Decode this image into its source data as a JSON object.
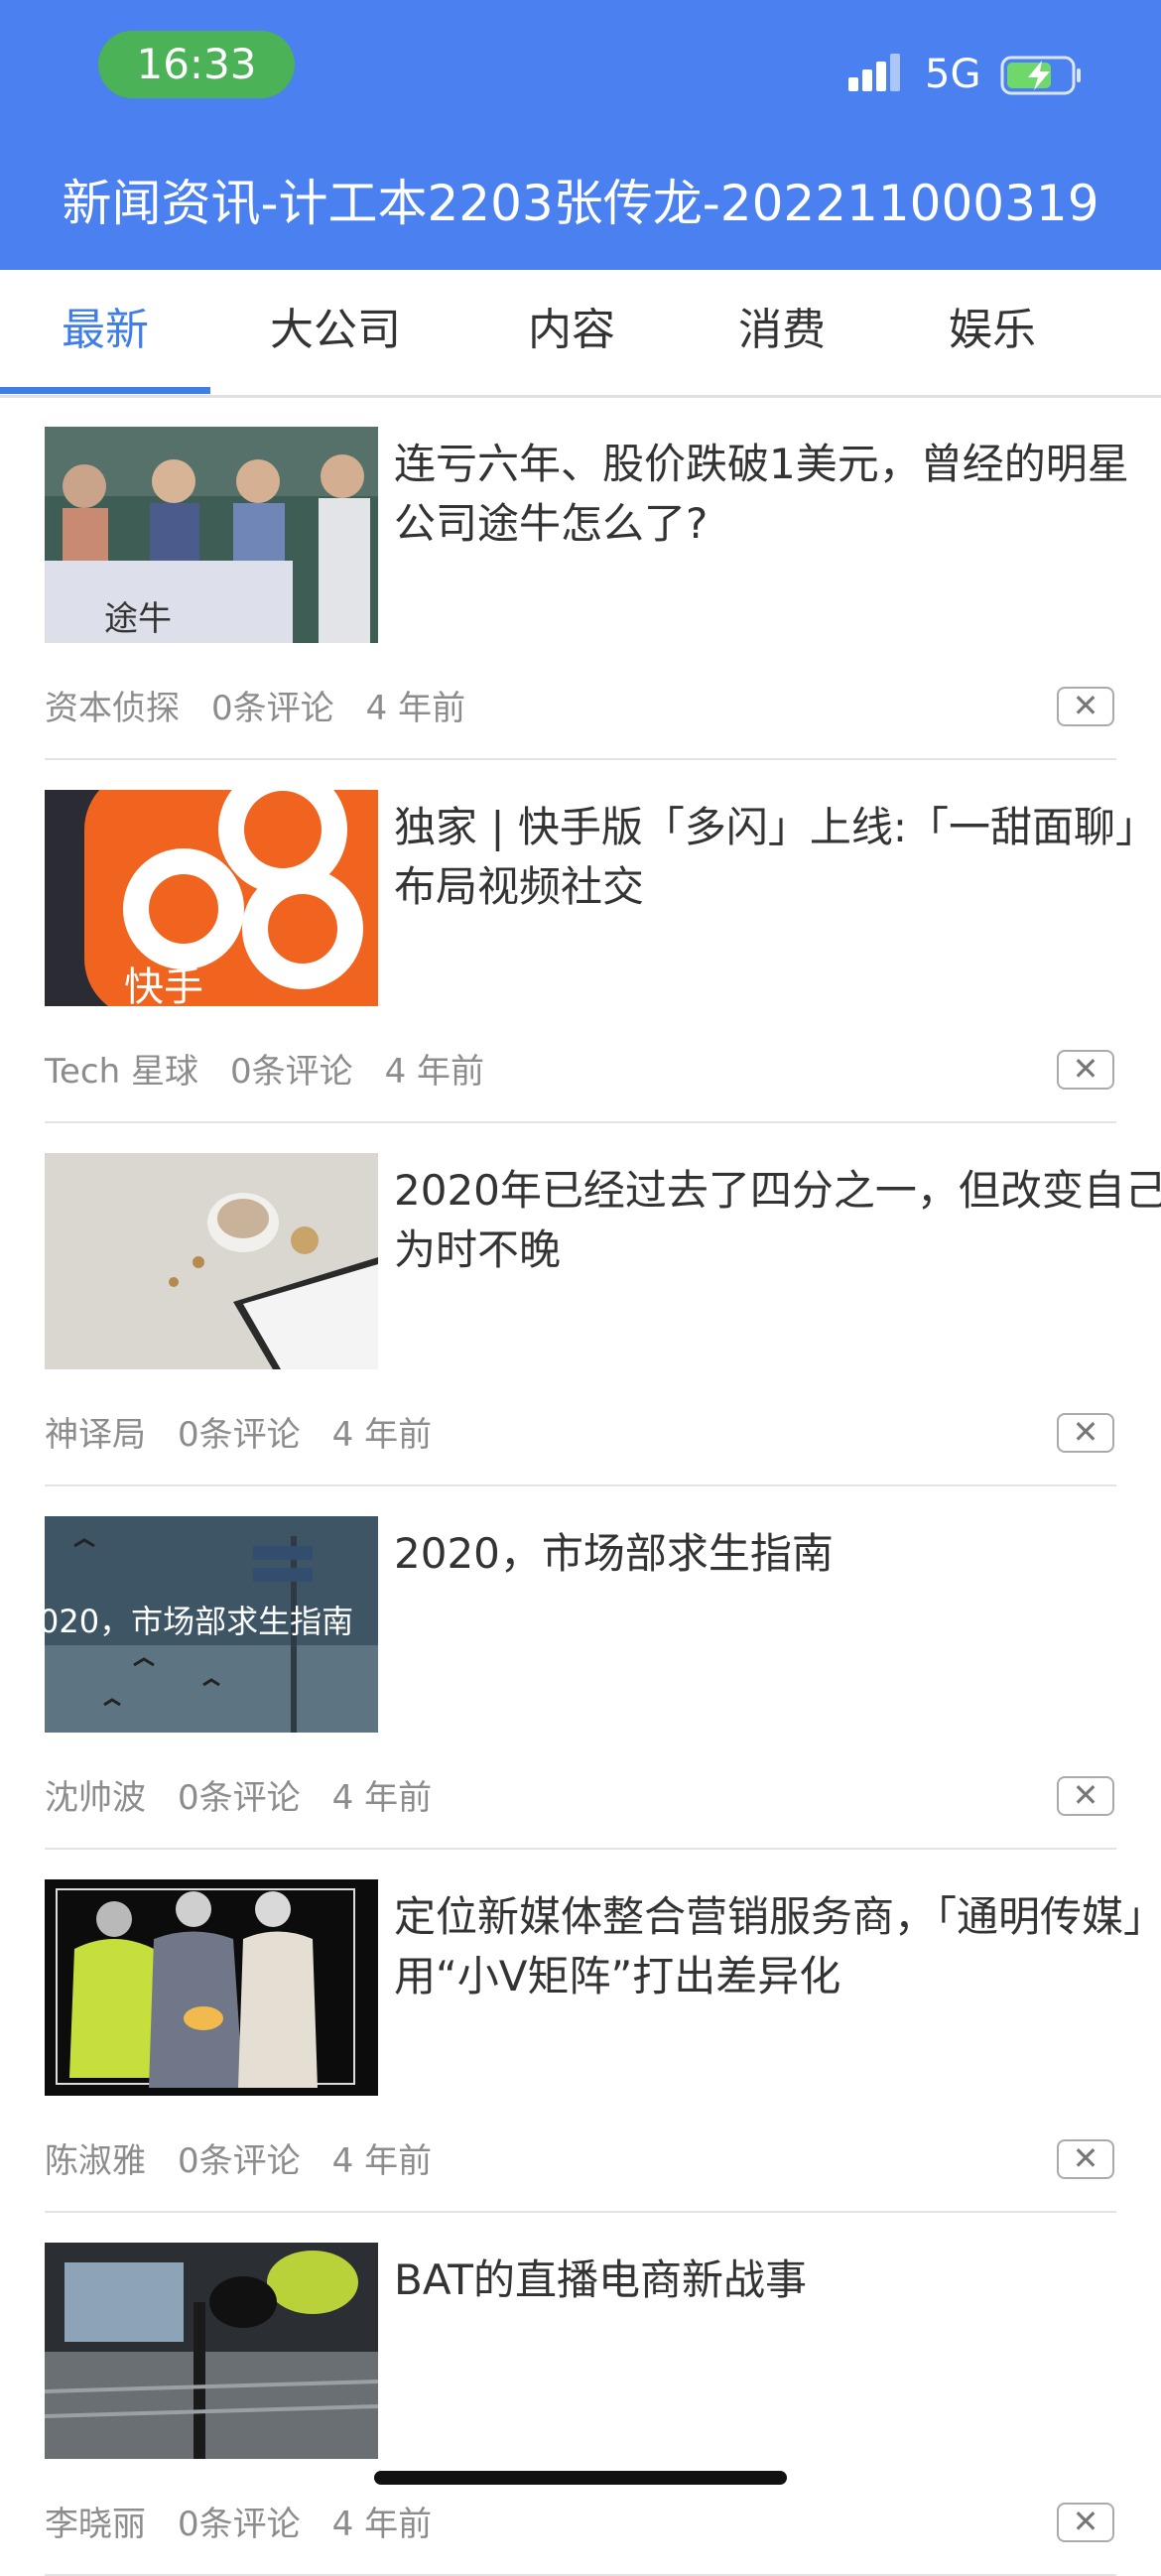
{
  "status_bar": {
    "time": "16:33",
    "network": "5G",
    "signal_icon": "signal-bars-icon",
    "battery_icon": "battery-charging-icon"
  },
  "app": {
    "title": "新闻资讯-计工本2203张传龙-202211000319",
    "accent": "#4a80ef",
    "tab_accent": "#3f7ee8"
  },
  "tabs": [
    {
      "label": "最新",
      "active": true
    },
    {
      "label": "大公司",
      "active": false
    },
    {
      "label": "内容",
      "active": false
    },
    {
      "label": "消费",
      "active": false
    },
    {
      "label": "娱乐",
      "active": false
    }
  ],
  "news": [
    {
      "title": "连亏六年、股价跌破1美元，曾经的明星公司途牛怎么了?",
      "source": "资本侦探",
      "comments": "0条评论",
      "time": "4 年前",
      "thumb_text": "途牛"
    },
    {
      "title": "独家 | 快手版「多闪」上线:「一甜面聊」布局视频社交",
      "source": "Tech 星球",
      "comments": "0条评论",
      "time": "4 年前",
      "thumb_text": "快手"
    },
    {
      "title": "2020年已经过去了四分之一，但改变自己为时不晚",
      "source": "神译局",
      "comments": "0条评论",
      "time": "4 年前"
    },
    {
      "title": "2020，市场部求生指南",
      "source": "沈帅波",
      "comments": "0条评论",
      "time": "4 年前",
      "thumb_text": "020，市场部求生指南"
    },
    {
      "title": "定位新媒体整合营销服务商，「通明传媒」用“小V矩阵”打出差异化",
      "source": "陈淑雅",
      "comments": "0条评论",
      "time": "4 年前"
    },
    {
      "title": "BAT的直播电商新战事",
      "source": "李晓丽",
      "comments": "0条评论",
      "time": "4 年前"
    }
  ],
  "close_label": "✕"
}
